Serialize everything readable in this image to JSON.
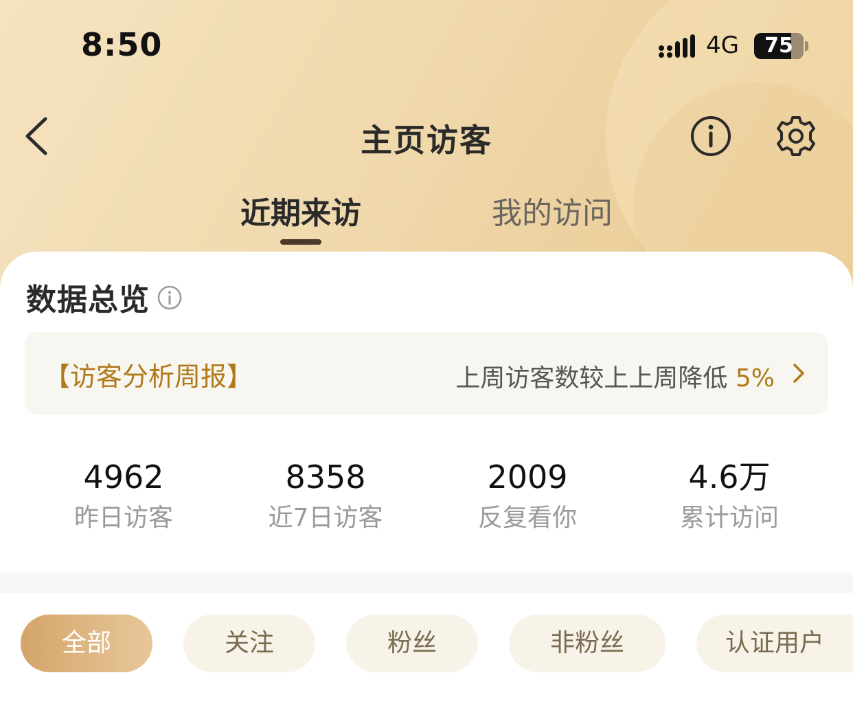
{
  "status_bar": {
    "time": "8:50",
    "network": "4G",
    "battery": "75",
    "battery_level": 0.75
  },
  "header": {
    "title": "主页访客"
  },
  "tabs": [
    {
      "label": "近期来访",
      "active": true
    },
    {
      "label": "我的访问",
      "active": false
    }
  ],
  "overview": {
    "title": "数据总览",
    "report": {
      "label": "【访客分析周报】",
      "summary_prefix": "上周访客数较上上周降低 ",
      "summary_highlight": "5%"
    },
    "stats": [
      {
        "value": "4962",
        "label": "昨日访客"
      },
      {
        "value": "8358",
        "label": "近7日访客"
      },
      {
        "value": "2009",
        "label": "反复看你"
      },
      {
        "value": "4.6万",
        "label": "累计访问"
      }
    ]
  },
  "filters": [
    {
      "label": "全部",
      "active": true
    },
    {
      "label": "关注",
      "active": false
    },
    {
      "label": "粉丝",
      "active": false
    },
    {
      "label": "非粉丝",
      "active": false
    },
    {
      "label": "认证用户",
      "active": false
    }
  ],
  "colors": {
    "accent": "#b07a1a",
    "chip_bg": "#f8f3e8",
    "active_chip_start": "#d4a56a",
    "header_gold": "#f0d9ad"
  },
  "icons": {
    "back": "chevron-left-icon",
    "info": "info-circle-icon",
    "settings": "gear-icon",
    "report_arrow": "chevron-right-icon"
  }
}
